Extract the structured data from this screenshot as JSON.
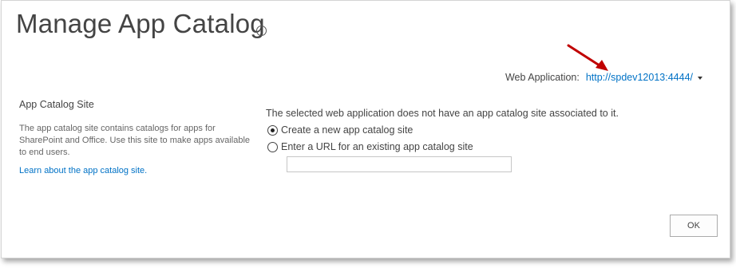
{
  "page": {
    "title": "Manage App Catalog",
    "info_icon": "info-icon"
  },
  "web_application": {
    "label": "Web Application:",
    "value": "http://spdev12013:4444/",
    "dropdown_icon": "caret-down-icon"
  },
  "annotation": {
    "arrow_icon": "red-arrow-icon",
    "color": "#c00000"
  },
  "section": {
    "title": "App Catalog Site",
    "description": "The app catalog site contains catalogs for apps for SharePoint and Office. Use this site to make apps available to end users.",
    "learn_link": "Learn about the app catalog site."
  },
  "form": {
    "notice": "The selected web application does not have an app catalog site associated to it.",
    "option_create": "Create a new app catalog site",
    "option_existing": "Enter a URL for an existing app catalog site",
    "url_value": "",
    "selected_option": "create"
  },
  "actions": {
    "ok_label": "OK"
  },
  "colors": {
    "link": "#0072c6",
    "text": "#444444",
    "arrow": "#c00000"
  }
}
